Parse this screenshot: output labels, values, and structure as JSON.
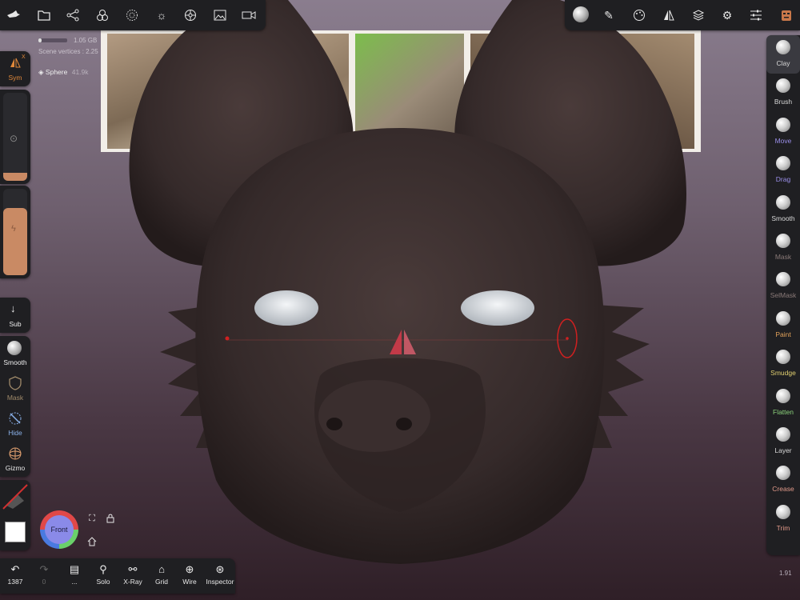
{
  "stats": {
    "memory": "1.05 GB",
    "scene_vertices": "Scene vertices : 2.25",
    "mesh_name": "Sphere",
    "mesh_vertices": "41.9k"
  },
  "top_left_icons": [
    "bird-icon",
    "folder-icon",
    "share-graph-icon",
    "shapes-icon",
    "dotted-sphere-icon",
    "sun-icon",
    "settings-wheel-icon",
    "image-icon",
    "video-camera-icon"
  ],
  "top_right_icons": [
    "matcap-ball-icon",
    "pencil-icon",
    "palette-icon",
    "symmetry-icon",
    "layers-icon",
    "gear-icon",
    "sliders-icon",
    "nomad-head-icon"
  ],
  "left_panel": {
    "sym_label": "Sym",
    "sym_badge": "X",
    "sub_label": "Sub",
    "smooth_label": "Smooth",
    "mask_label": "Mask",
    "hide_label": "Hide",
    "gizmo_label": "Gizmo"
  },
  "right_tools": [
    {
      "label": "Clay",
      "color": "#d8d8d8"
    },
    {
      "label": "Brush",
      "color": "#d8d8d8"
    },
    {
      "label": "Move",
      "color": "#9a8ee8"
    },
    {
      "label": "Drag",
      "color": "#9a8ee8"
    },
    {
      "label": "Smooth",
      "color": "#d8d8d8"
    },
    {
      "label": "Mask",
      "color": "#8a7a78"
    },
    {
      "label": "SelMask",
      "color": "#8a7a78"
    },
    {
      "label": "Paint",
      "color": "#e2a25a"
    },
    {
      "label": "Smudge",
      "color": "#e2d070"
    },
    {
      "label": "Flatten",
      "color": "#8ad07a"
    },
    {
      "label": "Layer",
      "color": "#d8d8d8"
    },
    {
      "label": "Crease",
      "color": "#e29a8a"
    },
    {
      "label": "Trim",
      "color": "#e29a8a"
    }
  ],
  "bottom": {
    "undo_count": "1387",
    "redo_count": "0",
    "page_label": "...",
    "solo": "Solo",
    "xray": "X-Ray",
    "grid": "Grid",
    "wire": "Wire",
    "inspector": "Inspector"
  },
  "view_cube": {
    "label": "Front"
  },
  "fps": "1.91"
}
